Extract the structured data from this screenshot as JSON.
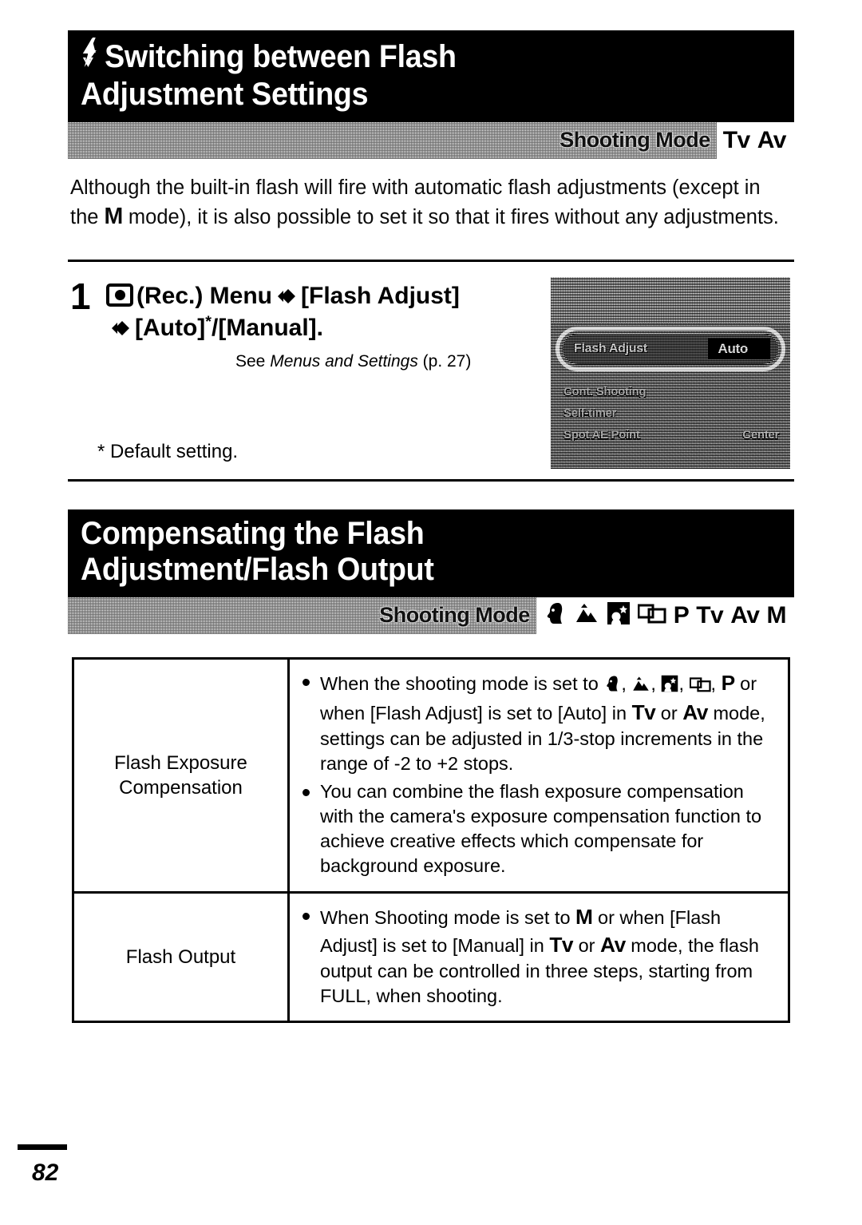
{
  "section1": {
    "title": "Switching between Flash\nAdjustment Settings",
    "title_icon": "flash-bolt-icon",
    "mode_label": "Shooting Mode",
    "mode_values": [
      "Tv",
      "Av"
    ],
    "intro": "Although the built-in flash will fire with automatic flash adjustments (except in the M mode), it is also possible to set it so that it fires without any adjustments.",
    "intro_parts": {
      "p1": "Although the built-in flash will fire with automatic flash adjustments (except in the ",
      "mode_glyph": "M",
      "p2": " mode), it is also possible to set it so that it fires without any adjustments."
    },
    "step": {
      "number": "1",
      "icon": "rec-camera-icon",
      "line1_a": "(Rec.) Menu",
      "line1_b": "[Flash Adjust]",
      "line2_a": "[Auto]",
      "line2_star": "*",
      "line2_b": "/[Manual].",
      "reference_prefix": "See ",
      "reference_italic": "Menus and Settings",
      "reference_suffix": " (p. 27)"
    },
    "default_note": "* Default setting."
  },
  "lcd_screen": {
    "highlighted_row_label": "Flash Adjust",
    "highlighted_row_value": "Auto",
    "rows": [
      {
        "label": "Cont. Shooting",
        "value": ""
      },
      {
        "label": "Self-timer",
        "value": ""
      },
      {
        "label": "Spot AE Point",
        "value": "Center"
      }
    ]
  },
  "section2": {
    "title": "Compensating the Flash\nAdjustment/Flash Output",
    "mode_label": "Shooting Mode",
    "mode_icons": [
      "portrait-mode-icon",
      "landscape-mode-icon",
      "night-scene-mode-icon",
      "stitch-assist-mode-icon"
    ],
    "mode_values": [
      "P",
      "Tv",
      "Av",
      "M"
    ]
  },
  "table": {
    "rows": [
      {
        "label": "Flash Exposure\nCompensation",
        "bullets": [
          {
            "segments": [
              {
                "t": "text",
                "v": "When the shooting mode is set to "
              },
              {
                "t": "icon",
                "v": "portrait-mode-icon"
              },
              {
                "t": "text",
                "v": ", "
              },
              {
                "t": "icon",
                "v": "landscape-mode-icon"
              },
              {
                "t": "text",
                "v": ", "
              },
              {
                "t": "icon",
                "v": "night-scene-mode-icon"
              },
              {
                "t": "text",
                "v": ", "
              },
              {
                "t": "icon",
                "v": "stitch-assist-mode-icon"
              },
              {
                "t": "text",
                "v": ", "
              },
              {
                "t": "glyph",
                "v": "P"
              },
              {
                "t": "text",
                "v": " or when [Flash Adjust] is set to [Auto] in "
              },
              {
                "t": "glyph",
                "v": "Tv"
              },
              {
                "t": "text",
                "v": " or "
              },
              {
                "t": "glyph",
                "v": "Av"
              },
              {
                "t": "text",
                "v": " mode, settings can be adjusted in 1/3-stop increments in the range of -2 to +2 stops."
              }
            ],
            "plain": "When the shooting mode is set to , , , , P or when [Flash Adjust] is set to [Auto] in Tv or Av mode, settings can be adjusted in 1/3-stop increments in the range of -2 to +2 stops."
          },
          {
            "segments": [
              {
                "t": "text",
                "v": "You can combine the flash exposure compensation with the camera's exposure compensation function to achieve creative effects which compensate for background exposure."
              }
            ],
            "plain": "You can combine the flash exposure compensation with the camera's exposure compensation function to achieve creative effects which compensate for background exposure."
          }
        ]
      },
      {
        "label": "Flash Output",
        "bullets": [
          {
            "segments": [
              {
                "t": "text",
                "v": "When Shooting mode is set to "
              },
              {
                "t": "glyph",
                "v": "M"
              },
              {
                "t": "text",
                "v": " or when [Flash Adjust] is set to [Manual] in "
              },
              {
                "t": "glyph",
                "v": "Tv"
              },
              {
                "t": "text",
                "v": " or "
              },
              {
                "t": "glyph",
                "v": "Av"
              },
              {
                "t": "text",
                "v": " mode, the flash output can be controlled in three steps, starting from FULL, when shooting."
              }
            ],
            "plain": "When Shooting mode is set to M or when [Flash Adjust] is set to [Manual] in Tv or Av mode, the flash output can be controlled in three steps, starting from FULL, when shooting."
          }
        ]
      }
    ]
  },
  "footer": {
    "page_number": "82"
  },
  "colors": {
    "header_bg": "#000000",
    "header_text": "#ffffff",
    "body_text": "#000000",
    "page_bg": "#ffffff"
  }
}
